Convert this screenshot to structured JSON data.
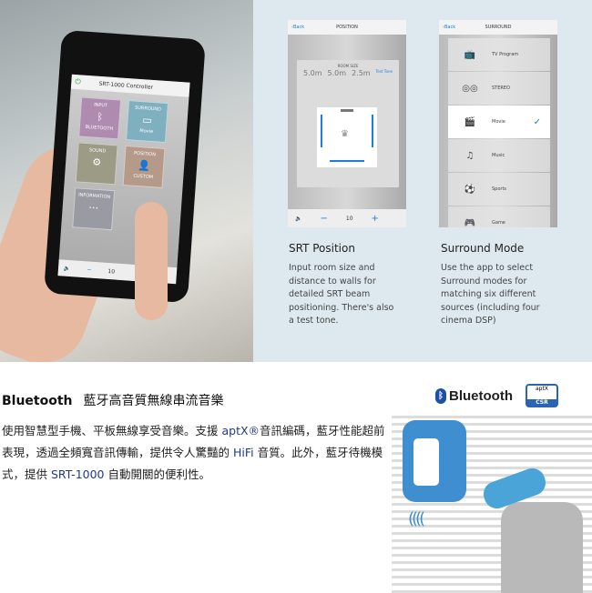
{
  "phone_app": {
    "title": "SRT-1000 Controller",
    "tiles": [
      {
        "label": "INPUT",
        "sub": "BLUETOOTH",
        "color": "#b08bb0"
      },
      {
        "label": "SURROUND",
        "sub": "Movie",
        "color": "#7fb0bf"
      },
      {
        "label": "SOUND",
        "sub": "",
        "color": "#9b9b86"
      },
      {
        "label": "POSITION",
        "sub": "CUSTOM",
        "color": "#b59a8a"
      },
      {
        "label": "INFORMATION",
        "sub": "",
        "color": "#9a9aa2"
      }
    ],
    "volume": "10"
  },
  "position_screen": {
    "back": "Back",
    "title": "POSITION",
    "room_size_label": "ROOM SIZE",
    "dims": [
      "5.0m",
      "5.0m",
      "2.5m"
    ],
    "test_tone": "Test Tone",
    "volume": "10",
    "minus": "−",
    "plus": "+"
  },
  "surround_screen": {
    "back": "Back",
    "title": "SURROUND",
    "modes": [
      {
        "label": "TV Program",
        "icon": "tv-icon"
      },
      {
        "label": "STEREO",
        "icon": "speakers-icon"
      },
      {
        "label": "Movie",
        "icon": "clapper-icon",
        "selected": true
      },
      {
        "label": "Music",
        "icon": "music-icon"
      },
      {
        "label": "Sports",
        "icon": "soccer-ball-icon"
      },
      {
        "label": "Game",
        "icon": "gamepad-icon"
      }
    ]
  },
  "captions": {
    "position": {
      "title": "SRT Position",
      "text": "Input room size and distance to walls for detailed SRT beam positioning. There's also a test tone."
    },
    "surround": {
      "title": "Surround Mode",
      "text": "Use the app to select Surround modes for matching six different sources (including four cinema DSP)"
    }
  },
  "section": {
    "title_en": "Bluetooth",
    "title_zh": "藍牙高音質無線串流音樂",
    "p1": "使用智慧型手機、平板無線享受音樂。支援 ",
    "aptx": "aptX®",
    "p2": "音訊編碼，藍牙性能超前表現，透過全頻寬音訊傳輸，提供令人驚豔的 ",
    "hifi": "HiFi",
    "p3": " 音質。此外，藍牙待機模式，提供 ",
    "model": "SRT-1000",
    "p4": " 自動開關的便利性。"
  },
  "logos": {
    "bluetooth": "Bluetooth",
    "aptx": "aptX",
    "csr": "CSR"
  },
  "colors": {
    "accent": "#1b7fe0",
    "panel_bg": "#dde9ef",
    "text_en": "#1e3a8a"
  }
}
